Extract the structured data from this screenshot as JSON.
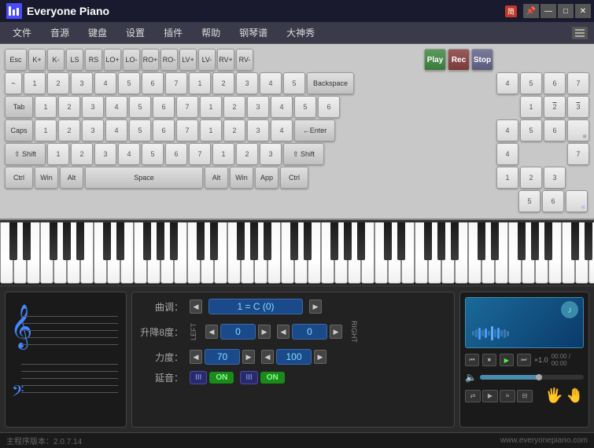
{
  "app": {
    "title": "Everyone Piano",
    "logo_text": "Everyone Piano",
    "lang_badge": "简",
    "version_label": "主程序版本：",
    "version": "2.0.7.14",
    "website": "www.everyonepiano.com"
  },
  "titlebar": {
    "minimize": "—",
    "maximize": "□",
    "close": "✕"
  },
  "menu": {
    "items": [
      "文件",
      "音源",
      "键盘",
      "设置",
      "插件",
      "帮助",
      "钢琴谱",
      "大神秀"
    ]
  },
  "keyboard": {
    "row0": {
      "esc": "Esc",
      "keys": [
        "K+",
        "K-",
        "LS",
        "RS",
        "LO+",
        "LO-",
        "RO+",
        "RO-",
        "LV+",
        "LV-",
        "RV+",
        "RV-"
      ],
      "play": "Play",
      "rec": "Rec",
      "stop": "Stop"
    },
    "row1_left": [
      "1",
      "2",
      "3",
      "4",
      "5",
      "6",
      "7",
      "1",
      "2",
      "3",
      "4",
      "5"
    ],
    "backspace": "Backspace",
    "row2": [
      "1",
      "2",
      "3",
      "4",
      "5",
      "6",
      "7",
      "1",
      "2",
      "3",
      "4",
      "5",
      "6"
    ],
    "tab": "Tab",
    "row3": [
      "1",
      "2",
      "3",
      "4",
      "5",
      "6",
      "7",
      "1",
      "2",
      "3",
      "4"
    ],
    "caps": "Caps",
    "enter": "←Enter",
    "row4": [
      "1",
      "2",
      "3",
      "4",
      "5",
      "6",
      "7",
      "1",
      "2",
      "3"
    ],
    "shift_l": "⇧ Shift",
    "shift_r": "⇧ Shift",
    "row5_bottom": [
      "Ctrl",
      "Win",
      "Alt",
      "Space",
      "Alt",
      "Win",
      "App",
      "Ctrl"
    ]
  },
  "numpad": {
    "rows": [
      [
        "4",
        "5",
        "6",
        "7"
      ],
      [
        "̣1",
        "2",
        "3",
        "ˉ"
      ],
      [
        "4",
        "5",
        "6",
        ""
      ],
      [
        "4",
        "",
        "",
        "7"
      ],
      [
        "1",
        "2",
        "3",
        ""
      ],
      [
        "",
        "5",
        "6",
        ""
      ]
    ]
  },
  "controls": {
    "key_label": "曲调：",
    "key_value": "1 = C (0)",
    "octave_label": "升降8度：",
    "octave_left": "0",
    "octave_right": "0",
    "velocity_label": "力度：",
    "velocity_left": "70",
    "velocity_right": "100",
    "sustain_label": "延音：",
    "sustain_left_icon": "III",
    "sustain_left_val": "ON",
    "sustain_right_icon": "III",
    "sustain_right_val": "ON",
    "left_label": "LEFT",
    "right_label": "RIGHT"
  },
  "player": {
    "speed": "×1.0",
    "time": "00:00 / 00:00",
    "volume_pct": 60,
    "controls": [
      "⏮",
      "⏹",
      "▶",
      "⏭"
    ],
    "music_note": "♪"
  }
}
